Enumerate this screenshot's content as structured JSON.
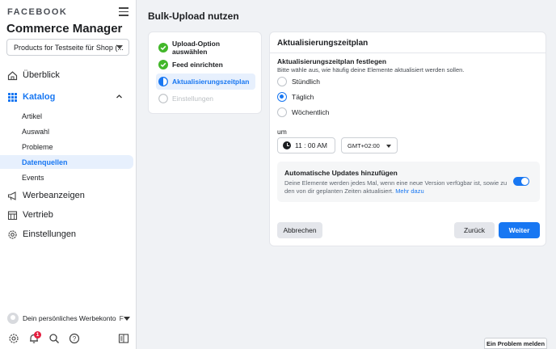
{
  "sidebar": {
    "brand": "FACEBOOK",
    "app_title": "Commerce Manager",
    "shop_select": "Products for Testseite für Shop (...",
    "nav": {
      "overview": "Überblick",
      "catalog": "Katalog",
      "catalog_items": [
        "Artikel",
        "Auswahl",
        "Probleme",
        "Datenquellen",
        "Events"
      ],
      "ads": "Werbeanzeigen",
      "sales": "Vertrieb",
      "settings": "Einstellungen"
    },
    "account": "Dein persönliches Werbekonto",
    "notification_count": "1"
  },
  "main": {
    "page_title": "Bulk-Upload nutzen",
    "steps": [
      {
        "label": "Upload-Option auswählen",
        "state": "done"
      },
      {
        "label": "Feed einrichten",
        "state": "done"
      },
      {
        "label": "Aktualisierungszeitplan",
        "state": "active"
      },
      {
        "label": "Einstellungen",
        "state": "disabled"
      }
    ],
    "schedule": {
      "title": "Aktualisierungszeitplan",
      "label": "Aktualisierungszeitplan festlegen",
      "help": "Bitte wähle aus, wie häufig deine Elemente aktualisiert werden sollen.",
      "options": [
        "Stündlich",
        "Täglich",
        "Wöchentlich"
      ],
      "selected": "Täglich",
      "at_label": "um",
      "time": "11 : 00 AM",
      "timezone": "GMT+02:00"
    },
    "auto_updates": {
      "title": "Automatische Updates hinzufügen",
      "desc": "Deine Elemente werden jedes Mal, wenn eine neue Version verfügbar ist, sowie zu den von dir geplanten Zeiten aktualisiert.",
      "link": "Mehr dazu",
      "enabled": true
    },
    "buttons": {
      "cancel": "Abbrechen",
      "back": "Zurück",
      "next": "Weiter"
    }
  },
  "report_problem": "Ein Problem melden",
  "colors": {
    "accent": "#1877f2",
    "success": "#42b72a",
    "badge": "#e41e3f"
  }
}
